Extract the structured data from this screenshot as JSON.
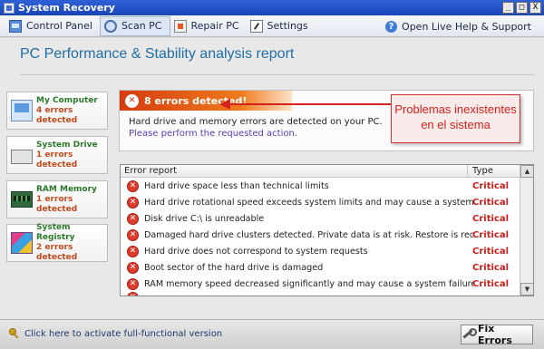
{
  "window": {
    "title": "System Recovery",
    "minimize": "_",
    "maximize": "□",
    "close": "X"
  },
  "menu": {
    "items": [
      {
        "label": "Control Panel",
        "icon": "control-panel-icon"
      },
      {
        "label": "Scan PC",
        "icon": "scan-icon"
      },
      {
        "label": "Repair PC",
        "icon": "repair-icon"
      },
      {
        "label": "Settings",
        "icon": "settings-icon"
      }
    ],
    "help_label": "Open Live Help & Support"
  },
  "page": {
    "title": "PC Performance & Stability analysis report"
  },
  "sidebar": {
    "items": [
      {
        "name": "My Computer",
        "count": "4 errors detected",
        "icon": "computer-icon"
      },
      {
        "name": "System Drive",
        "count": "1 errors detected",
        "icon": "drive-icon"
      },
      {
        "name": "RAM Memory",
        "count": "1 errors detected",
        "icon": "ram-icon"
      },
      {
        "name": "System Registry",
        "count": "2 errors detected",
        "icon": "registry-icon"
      }
    ]
  },
  "alert": {
    "title": "8 errors detected!",
    "line1": "Hard drive and memory errors are detected on your PC.",
    "line2": "Please perform the requested action."
  },
  "callout": {
    "text": "Problemas inexistentes en el sistema"
  },
  "table": {
    "col_report": "Error report",
    "col_type": "Type",
    "rows": [
      {
        "text": "Hard drive space less than technical limits",
        "type": "Critical"
      },
      {
        "text": "Hard drive rotational speed exceeds system limits and may cause a system failure",
        "type": "Critical"
      },
      {
        "text": "Disk drive C:\\ is unreadable",
        "type": "Critical"
      },
      {
        "text": "Damaged hard drive clusters detected. Private data is at risk. Restore is required",
        "type": "Critical"
      },
      {
        "text": "Hard drive does not correspond to system requests",
        "type": "Critical"
      },
      {
        "text": "Boot sector of the hard drive is damaged",
        "type": "Critical"
      },
      {
        "text": "RAM memory speed decreased significantly and may cause a system failure",
        "type": "Critical"
      }
    ]
  },
  "footer": {
    "activate_text": "Click here to activate full-functional version",
    "fix_label": "Fix Errors"
  },
  "colors": {
    "accent": "#1f6ea6",
    "critical": "#c4201a",
    "alert_start": "#d53b0f",
    "alert_end": "#f07a1c",
    "callout": "#d4221c"
  }
}
